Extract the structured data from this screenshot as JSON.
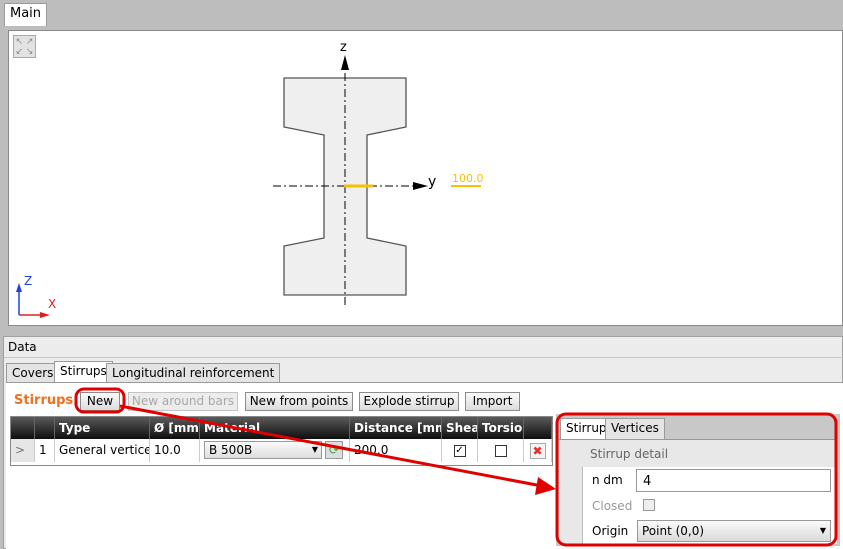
{
  "main_tab": "Main",
  "viewport": {
    "axis_z": "z",
    "axis_y": "y",
    "dimension": "100.0",
    "triad_z": "Z",
    "triad_x": "X",
    "highlight_color": "#f2c200"
  },
  "data_panel": {
    "title": "Data",
    "tabs": [
      {
        "label": "Covers"
      },
      {
        "label": "Stirrups"
      },
      {
        "label": "Longitudinal reinforcement"
      }
    ],
    "section_label": "Stirrups",
    "buttons": {
      "new": "New",
      "new_around_bars": "New around bars",
      "new_from_points": "New from points",
      "explode": "Explode stirrup",
      "import": "Import"
    },
    "table": {
      "headers": [
        "",
        "",
        "Type",
        "Ø [mm]",
        "Material",
        "Distance [mm]",
        "Shear",
        "Torsion",
        ""
      ],
      "rows": [
        {
          "expander": ">",
          "index": "1",
          "type": "General vertices",
          "diameter": "10.0",
          "material": "B 500B",
          "distance": "200.0",
          "shear": true,
          "torsion": false
        }
      ]
    },
    "detail": {
      "tabs": [
        {
          "label": "Stirrup"
        },
        {
          "label": "Vertices"
        }
      ],
      "header": "Stirrup detail",
      "n_dm_label": "n dm",
      "n_dm_value": "4",
      "closed_label": "Closed",
      "closed": false,
      "origin_label": "Origin",
      "origin_value": "Point (0,0)"
    }
  },
  "annotation_color": "#e00000"
}
